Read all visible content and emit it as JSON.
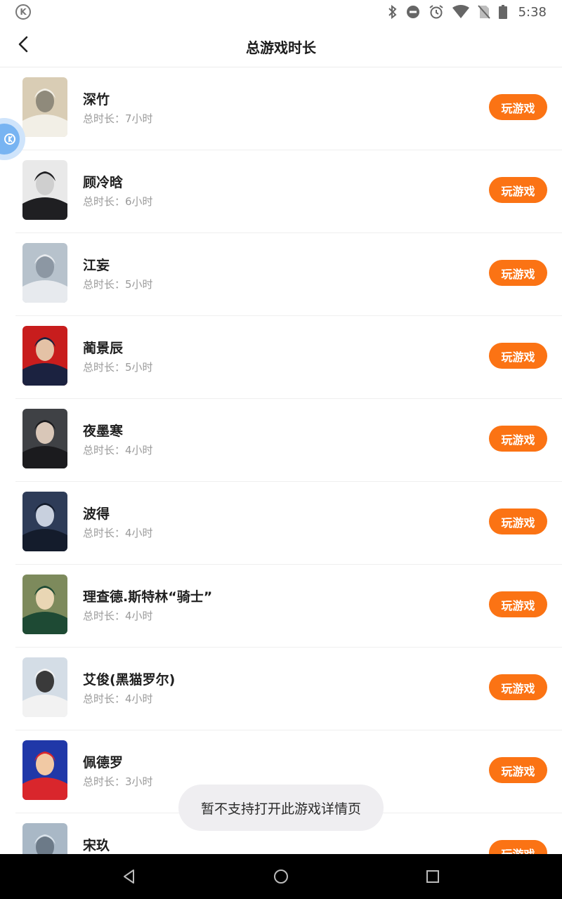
{
  "status_bar": {
    "time": "5:38",
    "icons": [
      "k-app-icon",
      "bluetooth-icon",
      "do-not-disturb-icon",
      "alarm-icon",
      "wifi-icon",
      "no-sim-icon",
      "battery-icon"
    ]
  },
  "header": {
    "title": "总游戏时长",
    "back_icon": "chevron-left-icon"
  },
  "games": [
    {
      "name": "深竹",
      "duration": "总时长：7小时",
      "button": "玩游戏",
      "avatar_colors": [
        "#d9cdb5",
        "#f2efe6",
        "#8f8a7b"
      ]
    },
    {
      "name": "顾冷晗",
      "duration": "总时长：6小时",
      "button": "玩游戏",
      "avatar_colors": [
        "#e9e9e9",
        "#1f1f22",
        "#cfcfcf"
      ]
    },
    {
      "name": "江妄",
      "duration": "总时长：5小时",
      "button": "玩游戏",
      "avatar_colors": [
        "#b7c2cc",
        "#e7eaee",
        "#8c97a3"
      ]
    },
    {
      "name": "蔺景辰",
      "duration": "总时长：5小时",
      "button": "玩游戏",
      "avatar_colors": [
        "#c81d1d",
        "#1b2240",
        "#e4c2a6"
      ]
    },
    {
      "name": "夜墨寒",
      "duration": "总时长：4小时",
      "button": "玩游戏",
      "avatar_colors": [
        "#3f4145",
        "#1b1b1e",
        "#d9c7b8"
      ]
    },
    {
      "name": "波得",
      "duration": "总时长：4小时",
      "button": "玩游戏",
      "avatar_colors": [
        "#2e3c58",
        "#141c2c",
        "#c8d0de"
      ]
    },
    {
      "name": "理查德.斯特林“骑士”",
      "duration": "总时长：4小时",
      "button": "玩游戏",
      "avatar_colors": [
        "#7d8a5c",
        "#1e4a34",
        "#e9d6b4"
      ]
    },
    {
      "name": "艾俊(黑猫罗尔)",
      "duration": "总时长：4小时",
      "button": "玩游戏",
      "avatar_colors": [
        "#d4dde6",
        "#f2f2f2",
        "#3a3a3a"
      ]
    },
    {
      "name": "佩德罗",
      "duration": "总时长：3小时",
      "button": "玩游戏",
      "avatar_colors": [
        "#2038a8",
        "#d9262c",
        "#f1c9a4"
      ]
    },
    {
      "name": "宋玖",
      "duration": "",
      "button": "玩游戏",
      "avatar_colors": [
        "#a9b8c6",
        "#d9e2ea",
        "#6c7a88"
      ]
    }
  ],
  "toast": {
    "message": "暂不支持打开此游戏详情页"
  },
  "nav_bar": {
    "buttons": [
      "back-triangle-icon",
      "home-circle-icon",
      "recents-square-icon"
    ]
  },
  "colors": {
    "accent": "#fb7314",
    "text_primary": "#1f1f1f",
    "text_secondary": "#9a9a9a",
    "divider": "#efefef"
  }
}
